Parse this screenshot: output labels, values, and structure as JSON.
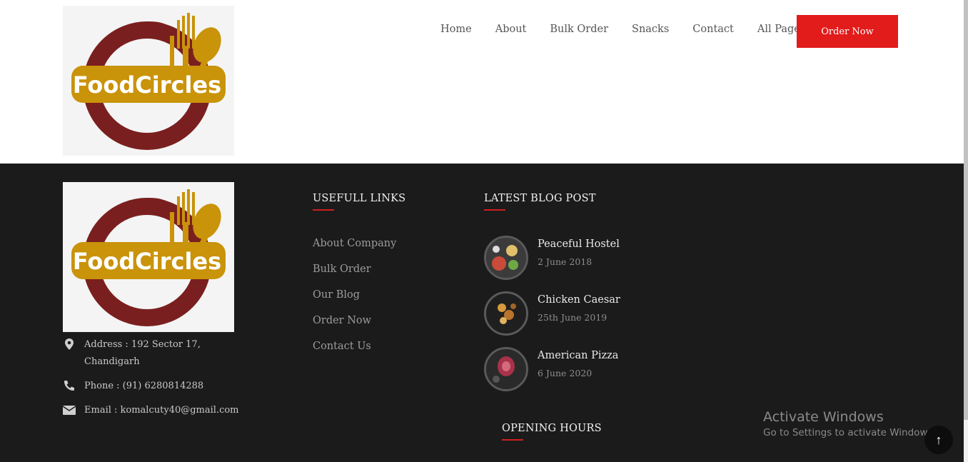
{
  "brand": {
    "name": "FoodCircles",
    "colors": {
      "maroon": "#7a1f1f",
      "gold": "#c9930a"
    }
  },
  "nav": {
    "items": [
      "Home",
      "About",
      "Bulk Order",
      "Snacks",
      "Contact",
      "All Pages"
    ],
    "order_button": "Order Now",
    "order_color": "#e21b1b"
  },
  "footer": {
    "contact": {
      "address": "Address : 192 Sector 17, Chandigarh",
      "phone": "Phone : (91) 6280814288",
      "email": "Email : komalcuty40@gmail.com"
    },
    "useful_links": {
      "title": "USEFULL LINKS",
      "items": [
        "About Company",
        "Bulk Order",
        "Our Blog",
        "Order Now",
        "Contact Us"
      ]
    },
    "blog": {
      "title": "LATEST BLOG POST",
      "posts": [
        {
          "title": "Peaceful Hostel",
          "date": "2 June 2018"
        },
        {
          "title": "Chicken Caesar",
          "date": "25th June 2019"
        },
        {
          "title": "American Pizza",
          "date": "6 June 2020"
        }
      ]
    },
    "opening_hours": {
      "title": "OPENING HOURS"
    }
  },
  "watermark": {
    "line1": "Activate Windows",
    "line2": "Go to Settings to activate Windows."
  },
  "to_top": {
    "icon": "arrow-up-icon",
    "glyph": "↑"
  }
}
